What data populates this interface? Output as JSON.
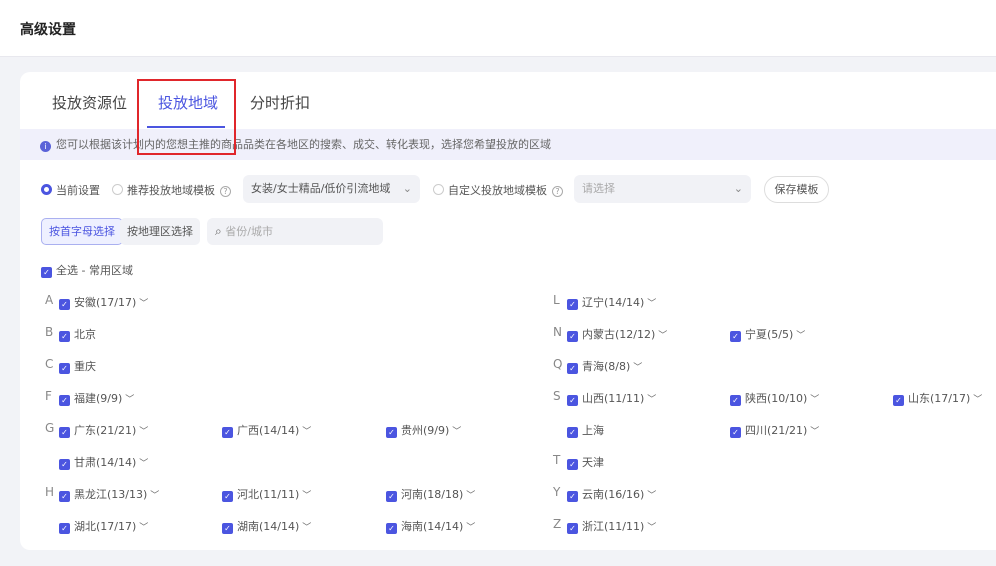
{
  "header": {
    "title": "高级设置"
  },
  "tabs": [
    {
      "label": "投放资源位"
    },
    {
      "label": "投放地域",
      "active": true
    },
    {
      "label": "分时折扣"
    }
  ],
  "info": {
    "icon": "info-icon",
    "text": "您可以根据该计划内的您想主推的商品品类在各地区的搜索、成交、转化表现，选择您希望投放的区域"
  },
  "options": {
    "current": "当前设置",
    "recommended": "推荐投放地域模板",
    "recommended_value": "女装/女士精品/低价引流地域",
    "custom": "自定义投放地域模板",
    "custom_placeholder": "请选择",
    "save": "保存模板"
  },
  "mode": {
    "by_letter": "按首字母选择",
    "by_region": "按地理区选择"
  },
  "search": {
    "placeholder": "省份/城市"
  },
  "select_all": "全选 - 常用区域",
  "accent": "#4b55e0",
  "rows": [
    {
      "left": {
        "letter": "A",
        "items": [
          {
            "label": "安徽(17/17)",
            "expand": true
          }
        ]
      },
      "right": {
        "letter": "L",
        "items": [
          {
            "label": "辽宁(14/14)",
            "expand": true
          }
        ]
      }
    },
    {
      "left": {
        "letter": "B",
        "items": [
          {
            "label": "北京"
          }
        ]
      },
      "right": {
        "letter": "N",
        "items": [
          {
            "label": "内蒙古(12/12)",
            "expand": true
          },
          {
            "label": "宁夏(5/5)",
            "expand": true
          }
        ]
      }
    },
    {
      "left": {
        "letter": "C",
        "items": [
          {
            "label": "重庆"
          }
        ]
      },
      "right": {
        "letter": "Q",
        "items": [
          {
            "label": "青海(8/8)",
            "expand": true
          }
        ]
      }
    },
    {
      "left": {
        "letter": "F",
        "items": [
          {
            "label": "福建(9/9)",
            "expand": true
          }
        ]
      },
      "right": {
        "letter": "S",
        "items": [
          {
            "label": "山西(11/11)",
            "expand": true
          },
          {
            "label": "陕西(10/10)",
            "expand": true
          },
          {
            "label": "山东(17/17)",
            "expand": true
          }
        ]
      }
    },
    {
      "left": {
        "letter": "G",
        "items": [
          {
            "label": "广东(21/21)",
            "expand": true
          },
          {
            "label": "广西(14/14)",
            "expand": true
          },
          {
            "label": "贵州(9/9)",
            "expand": true
          }
        ]
      },
      "right": {
        "letter": "",
        "items": [
          {
            "label": "上海"
          },
          {
            "label": "四川(21/21)",
            "expand": true
          }
        ]
      }
    },
    {
      "left": {
        "letter": "",
        "items": [
          {
            "label": "甘肃(14/14)",
            "expand": true
          }
        ]
      },
      "right": {
        "letter": "T",
        "items": [
          {
            "label": "天津"
          }
        ]
      }
    },
    {
      "left": {
        "letter": "H",
        "items": [
          {
            "label": "黑龙江(13/13)",
            "expand": true
          },
          {
            "label": "河北(11/11)",
            "expand": true
          },
          {
            "label": "河南(18/18)",
            "expand": true
          }
        ]
      },
      "right": {
        "letter": "Y",
        "items": [
          {
            "label": "云南(16/16)",
            "expand": true
          }
        ]
      }
    },
    {
      "left": {
        "letter": "",
        "items": [
          {
            "label": "湖北(17/17)",
            "expand": true
          },
          {
            "label": "湖南(14/14)",
            "expand": true
          },
          {
            "label": "海南(14/14)",
            "expand": true
          }
        ]
      },
      "right": {
        "letter": "Z",
        "items": [
          {
            "label": "浙江(11/11)",
            "expand": true
          }
        ]
      }
    }
  ]
}
